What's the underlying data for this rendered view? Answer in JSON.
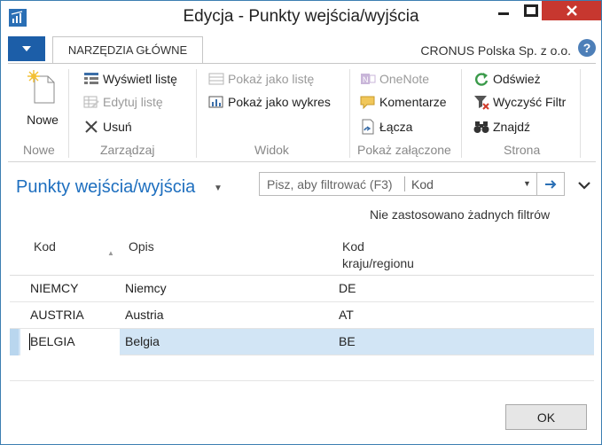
{
  "window": {
    "title": "Edycja - Punkty wejścia/wyjścia",
    "minimize_glyph": "—",
    "maximize_glyph": "☐",
    "close_glyph": "✕"
  },
  "ribbon": {
    "tab": "NARZĘDZIA GŁÓWNE",
    "company": "CRONUS Polska Sp. z o.o.",
    "help_glyph": "?",
    "groups": {
      "nowe": {
        "label": "Nowe",
        "new_label": "Nowe"
      },
      "zarzadzaj": {
        "label": "Zarządzaj",
        "view_list": "Wyświetl listę",
        "edit_list": "Edytuj listę",
        "delete": "Usuń"
      },
      "widok": {
        "label": "Widok",
        "show_list": "Pokaż jako listę",
        "show_chart": "Pokaż jako wykres"
      },
      "pokaz_zalaczone": {
        "label": "Pokaż załączone",
        "onenote": "OneNote",
        "comments": "Komentarze",
        "links": "Łącza"
      },
      "strona": {
        "label": "Strona",
        "refresh": "Odśwież",
        "clear_filter": "Wyczyść Filtr",
        "find": "Znajdź"
      }
    }
  },
  "page": {
    "title": "Punkty wejścia/wyjścia",
    "filter_placeholder": "Pisz, aby filtrować (F3)",
    "filter_field": "Kod",
    "no_filters": "Nie zastosowano żadnych filtrów"
  },
  "grid": {
    "columns": {
      "code": "Kod",
      "description": "Opis",
      "country_line1": "Kod",
      "country_line2": "kraju/regionu"
    },
    "rows": [
      {
        "code": "NIEMCY",
        "description": "Niemcy",
        "country": "DE"
      },
      {
        "code": "AUSTRIA",
        "description": "Austria",
        "country": "AT"
      },
      {
        "code": "BELGIA",
        "description": "Belgia",
        "country": "BE"
      }
    ]
  },
  "footer": {
    "ok_label": "OK"
  },
  "colors": {
    "accent": "#1e6fbf",
    "selection": "#d2e5f5",
    "close": "#c7372f"
  }
}
